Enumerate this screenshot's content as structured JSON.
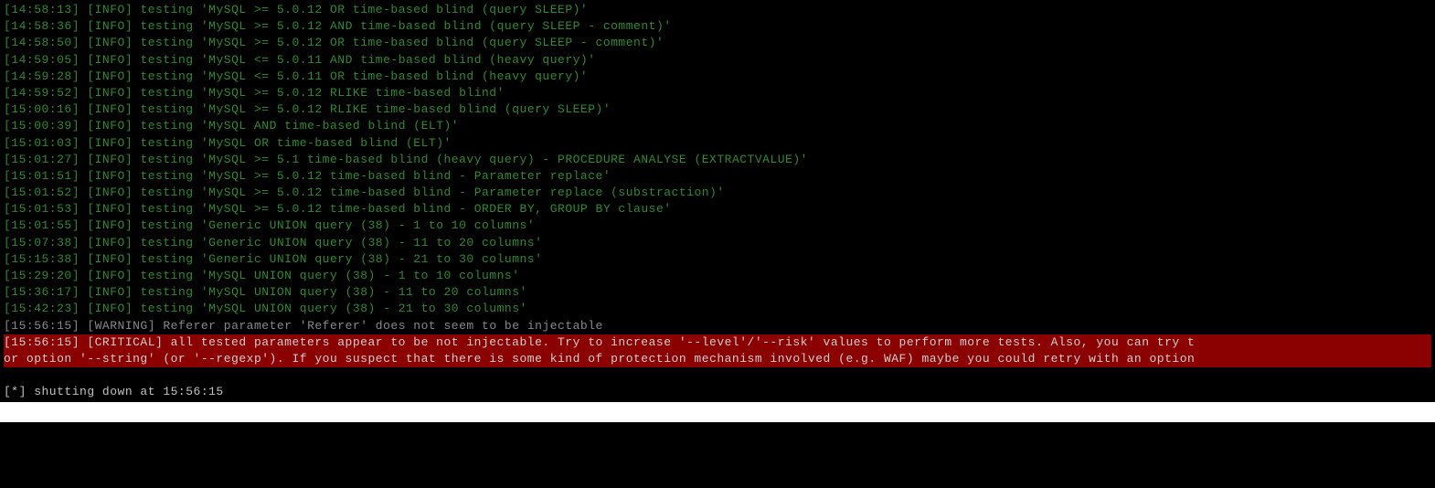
{
  "lines": [
    {
      "ts": "[14:58:13]",
      "level": "[INFO]",
      "msg": "testing 'MySQL >= 5.0.12 OR time-based blind (query SLEEP)'",
      "type": "info"
    },
    {
      "ts": "[14:58:36]",
      "level": "[INFO]",
      "msg": "testing 'MySQL >= 5.0.12 AND time-based blind (query SLEEP - comment)'",
      "type": "info"
    },
    {
      "ts": "[14:58:50]",
      "level": "[INFO]",
      "msg": "testing 'MySQL >= 5.0.12 OR time-based blind (query SLEEP - comment)'",
      "type": "info"
    },
    {
      "ts": "[14:59:05]",
      "level": "[INFO]",
      "msg": "testing 'MySQL <= 5.0.11 AND time-based blind (heavy query)'",
      "type": "info"
    },
    {
      "ts": "[14:59:28]",
      "level": "[INFO]",
      "msg": "testing 'MySQL <= 5.0.11 OR time-based blind (heavy query)'",
      "type": "info"
    },
    {
      "ts": "[14:59:52]",
      "level": "[INFO]",
      "msg": "testing 'MySQL >= 5.0.12 RLIKE time-based blind'",
      "type": "info"
    },
    {
      "ts": "[15:00:16]",
      "level": "[INFO]",
      "msg": "testing 'MySQL >= 5.0.12 RLIKE time-based blind (query SLEEP)'",
      "type": "info"
    },
    {
      "ts": "[15:00:39]",
      "level": "[INFO]",
      "msg": "testing 'MySQL AND time-based blind (ELT)'",
      "type": "info"
    },
    {
      "ts": "[15:01:03]",
      "level": "[INFO]",
      "msg": "testing 'MySQL OR time-based blind (ELT)'",
      "type": "info"
    },
    {
      "ts": "[15:01:27]",
      "level": "[INFO]",
      "msg": "testing 'MySQL >= 5.1 time-based blind (heavy query) - PROCEDURE ANALYSE (EXTRACTVALUE)'",
      "type": "info"
    },
    {
      "ts": "[15:01:51]",
      "level": "[INFO]",
      "msg": "testing 'MySQL >= 5.0.12 time-based blind - Parameter replace'",
      "type": "info"
    },
    {
      "ts": "[15:01:52]",
      "level": "[INFO]",
      "msg": "testing 'MySQL >= 5.0.12 time-based blind - Parameter replace (substraction)'",
      "type": "info"
    },
    {
      "ts": "[15:01:53]",
      "level": "[INFO]",
      "msg": "testing 'MySQL >= 5.0.12 time-based blind - ORDER BY, GROUP BY clause'",
      "type": "info"
    },
    {
      "ts": "[15:01:55]",
      "level": "[INFO]",
      "msg": "testing 'Generic UNION query (38) - 1 to 10 columns'",
      "type": "info"
    },
    {
      "ts": "[15:07:38]",
      "level": "[INFO]",
      "msg": "testing 'Generic UNION query (38) - 11 to 20 columns'",
      "type": "info"
    },
    {
      "ts": "[15:15:38]",
      "level": "[INFO]",
      "msg": "testing 'Generic UNION query (38) - 21 to 30 columns'",
      "type": "info"
    },
    {
      "ts": "[15:29:20]",
      "level": "[INFO]",
      "msg": "testing 'MySQL UNION query (38) - 1 to 10 columns'",
      "type": "info"
    },
    {
      "ts": "[15:36:17]",
      "level": "[INFO]",
      "msg": "testing 'MySQL UNION query (38) - 11 to 20 columns'",
      "type": "info"
    },
    {
      "ts": "[15:42:23]",
      "level": "[INFO]",
      "msg": "testing 'MySQL UNION query (38) - 21 to 30 columns'",
      "type": "info"
    },
    {
      "ts": "[15:56:15]",
      "level": "[WARNING]",
      "msg": "Referer parameter 'Referer' does not seem to be injectable",
      "type": "warning"
    }
  ],
  "critical": {
    "row1": "[15:56:15] [CRITICAL] all tested parameters appear to be not injectable. Try to increase '--level'/'--risk' values to perform more tests. Also, you can try t",
    "row2": "or option '--string' (or '--regexp'). If you suspect that there is some kind of protection mechanism involved (e.g. WAF) maybe you could retry with an option"
  },
  "shutdown": "[*] shutting down at 15:56:15"
}
